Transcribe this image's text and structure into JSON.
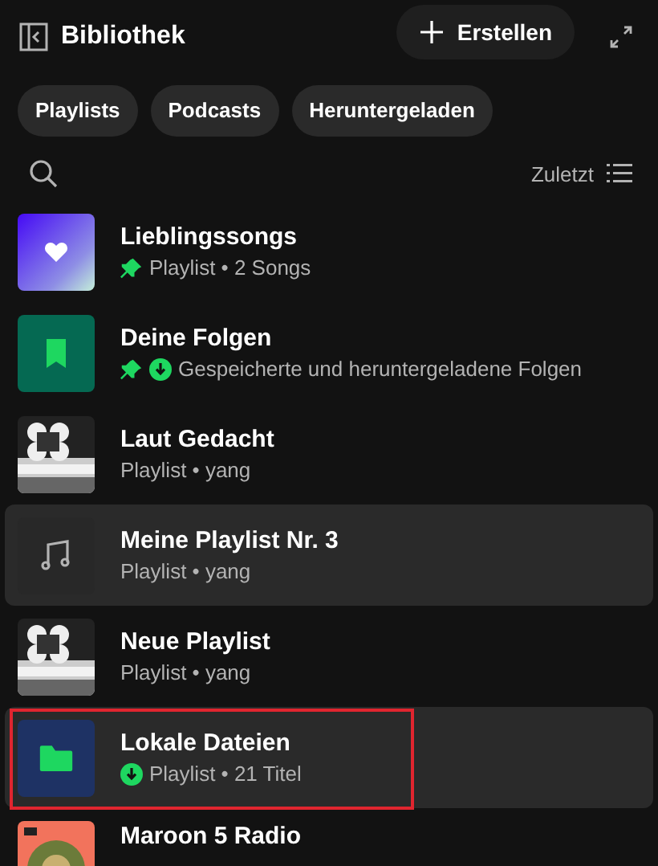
{
  "header": {
    "title": "Bibliothek",
    "create_button": "Erstellen"
  },
  "filters": [
    {
      "label": "Playlists",
      "selected": false
    },
    {
      "label": "Podcasts",
      "selected": false
    },
    {
      "label": "Heruntergeladen",
      "selected": false
    }
  ],
  "sort": {
    "label": "Zuletzt"
  },
  "items": [
    {
      "title": "Lieblingssongs",
      "subtitle": "Playlist • 2 Songs",
      "kind": "liked",
      "pinned": true,
      "downloaded": false,
      "selected": false,
      "annotated": false
    },
    {
      "title": "Deine Folgen",
      "subtitle": "Gespeicherte und heruntergeladene Folgen",
      "kind": "episodes",
      "pinned": true,
      "downloaded": true,
      "selected": false,
      "annotated": false
    },
    {
      "title": "Laut Gedacht",
      "subtitle": "Playlist • yang",
      "kind": "picture",
      "pinned": false,
      "downloaded": false,
      "selected": false,
      "annotated": false
    },
    {
      "title": "Meine Playlist Nr. 3",
      "subtitle": "Playlist • yang",
      "kind": "note",
      "pinned": false,
      "downloaded": false,
      "selected": true,
      "annotated": false
    },
    {
      "title": "Neue Playlist",
      "subtitle": "Playlist • yang",
      "kind": "picture",
      "pinned": false,
      "downloaded": false,
      "selected": false,
      "annotated": false
    },
    {
      "title": "Lokale Dateien",
      "subtitle": "Playlist • 21 Titel",
      "kind": "folder",
      "pinned": false,
      "downloaded": true,
      "selected": true,
      "annotated": true
    },
    {
      "title": "Maroon 5 Radio",
      "kind": "radio",
      "pinned": false,
      "downloaded": false,
      "selected": false,
      "annotated": false
    }
  ]
}
